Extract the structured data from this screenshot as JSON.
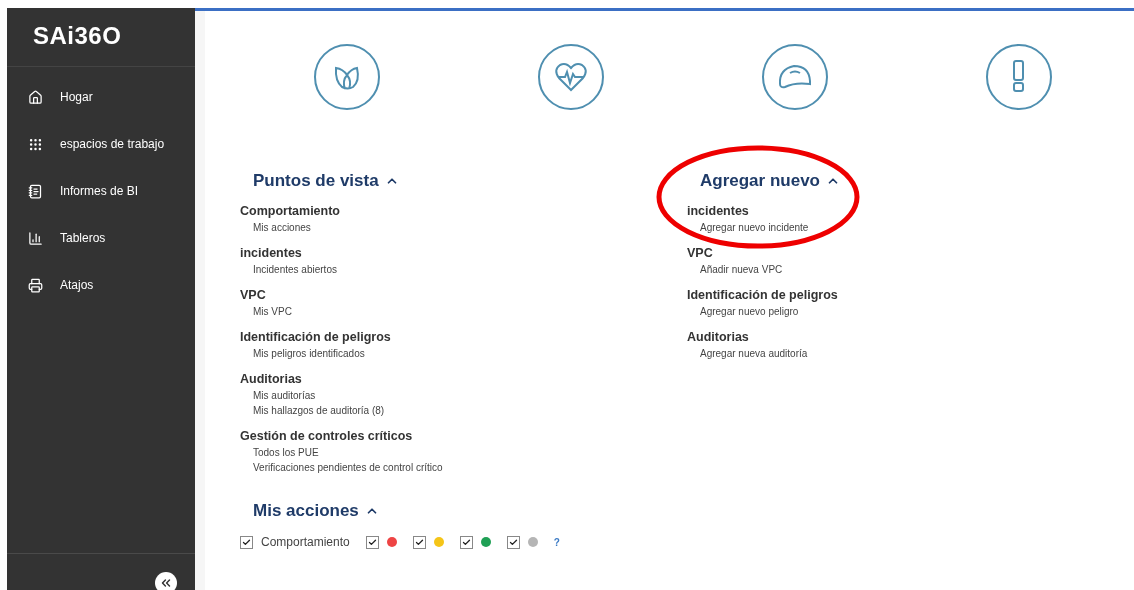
{
  "sidebar": {
    "logo": "SAi36O",
    "items": [
      {
        "kind": "home",
        "label": "Hogar"
      },
      {
        "kind": "grid",
        "label": "espacios de trabajo"
      },
      {
        "kind": "report",
        "label": "Informes de BI"
      },
      {
        "kind": "chart",
        "label": "Tableros"
      },
      {
        "kind": "shortcut",
        "label": "Atajos"
      }
    ]
  },
  "categories": [
    {
      "kind": "leaf"
    },
    {
      "kind": "heart"
    },
    {
      "kind": "helmet"
    },
    {
      "kind": "alert"
    }
  ],
  "columns": [
    {
      "title": "Puntos de vista",
      "expanded": true,
      "groups": [
        {
          "title": "Comportamiento",
          "links": [
            "Mis acciones"
          ]
        },
        {
          "title": "incidentes",
          "links": [
            "Incidentes abiertos"
          ]
        },
        {
          "title": "VPC",
          "links": [
            "Mis VPC"
          ]
        },
        {
          "title": "Identificación de peligros",
          "links": [
            "Mis peligros identificados"
          ]
        },
        {
          "title": "Auditorias",
          "links": [
            "Mis auditorías",
            "Mis hallazgos de auditoría (8)"
          ]
        },
        {
          "title": "Gestión de controles críticos",
          "links": [
            "Todos los PUE",
            "Verificaciones pendientes de control crítico"
          ]
        }
      ]
    },
    {
      "title": "Agregar nuevo",
      "expanded": true,
      "highlighted": true,
      "groups": [
        {
          "title": "incidentes",
          "links": [
            "Agregar nuevo incidente"
          ]
        },
        {
          "title": "VPC",
          "links": [
            "Añadir nueva VPC"
          ]
        },
        {
          "title": "Identificación de peligros",
          "links": [
            "Agregar nuevo peligro"
          ]
        },
        {
          "title": "Auditorias",
          "links": [
            "Agregar nueva auditoría"
          ]
        }
      ]
    }
  ],
  "my_actions": {
    "title": "Mis acciones",
    "expanded": true,
    "filters": [
      {
        "kind": "label",
        "label": "Comportamiento",
        "checked": true
      },
      {
        "kind": "dot",
        "color": "#ee4444",
        "checked": true
      },
      {
        "kind": "dot",
        "color": "#f5c518",
        "checked": true
      },
      {
        "kind": "dot",
        "color": "#1fa055",
        "checked": true
      },
      {
        "kind": "dot",
        "color": "#b5b5b5",
        "checked": true
      }
    ],
    "help": "?"
  }
}
